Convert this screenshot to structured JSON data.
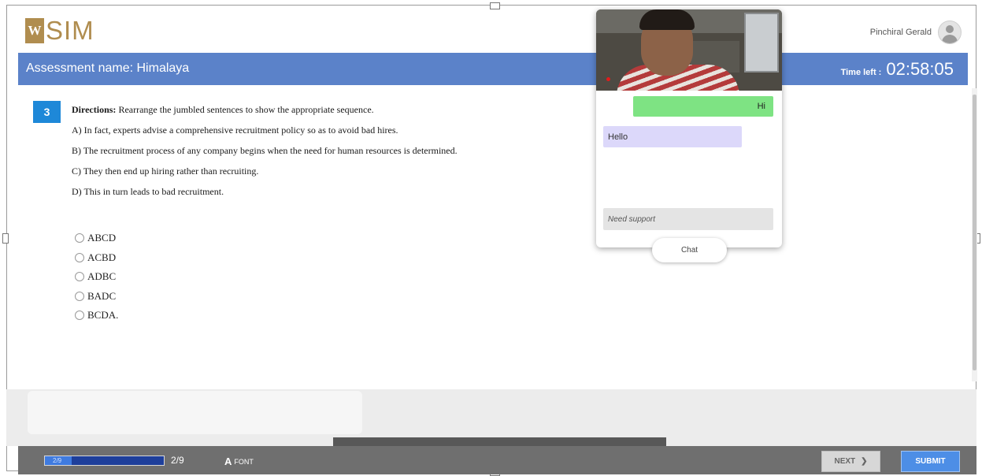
{
  "header": {
    "logo_mark": "W",
    "logo_text": "SIM",
    "user_name": "Pinchiral Gerald"
  },
  "assessment_bar": {
    "assessment_label": "Assessment name: Himalaya",
    "time_left_label": "Time left :",
    "time_left_value": "02:58:05"
  },
  "question": {
    "number": "3",
    "directions_label": "Directions:",
    "directions_text": " Rearrange the jumbled sentences to show the appropriate sequence.",
    "sentences": [
      "A) In fact, experts advise a comprehensive recruitment policy so as to avoid bad hires.",
      "B) The recruitment process of any company begins when the need for human resources is determined.",
      "C) They then end up hiring rather than recruiting.",
      "D) This in turn leads to bad recruitment."
    ],
    "options": [
      "ABCD",
      "ACBD",
      "ADBC",
      "BADC",
      "BCDA."
    ]
  },
  "proctor_panel": {
    "webcam_icon": "webcam-feed",
    "messages": [
      {
        "direction": "outgoing",
        "text": "Hi"
      },
      {
        "direction": "incoming",
        "text": "Hello"
      }
    ],
    "input_value": "Need support",
    "chat_button_label": "Chat"
  },
  "footer": {
    "progress_label": "2/9",
    "progress_fraction": 0.222,
    "progress_count": "2/9",
    "font_label": "FONT",
    "font_icon_glyph": "A",
    "next_label": "NEXT",
    "next_icon_glyph": "❯",
    "submit_label": "SUBMIT"
  },
  "colors": {
    "accent_bar": "#5b82c9",
    "logo_gold": "#b08d4f",
    "question_badge": "#1e88d8",
    "outgoing_bubble": "#7ee383",
    "incoming_bubble": "#dcd8fa",
    "submit": "#4d8ee6"
  }
}
